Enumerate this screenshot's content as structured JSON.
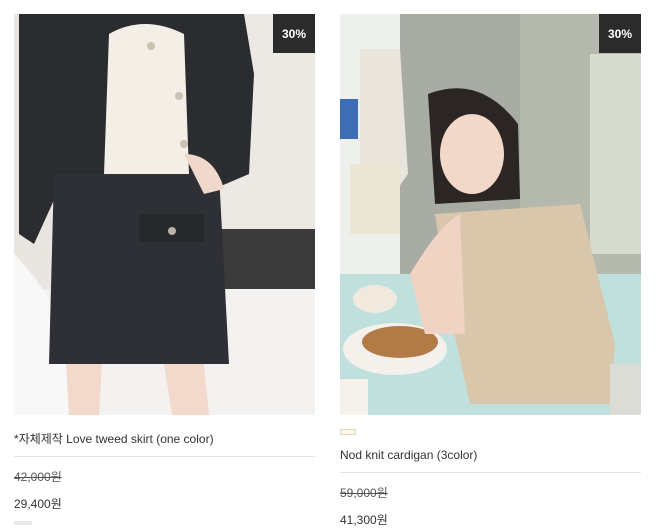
{
  "products": [
    {
      "discount_badge": "30%",
      "name": "*자체제작 Love tweed skirt (one color)",
      "original_price": "42,000원",
      "sale_price": "29,400원"
    },
    {
      "discount_badge": "30%",
      "name": "Nod knit cardigan (3color)",
      "original_price": "59,000원",
      "sale_price": "41,300원"
    }
  ],
  "colors": {
    "badge_bg": "#2b2b2b",
    "divider": "#e3e3e3"
  }
}
